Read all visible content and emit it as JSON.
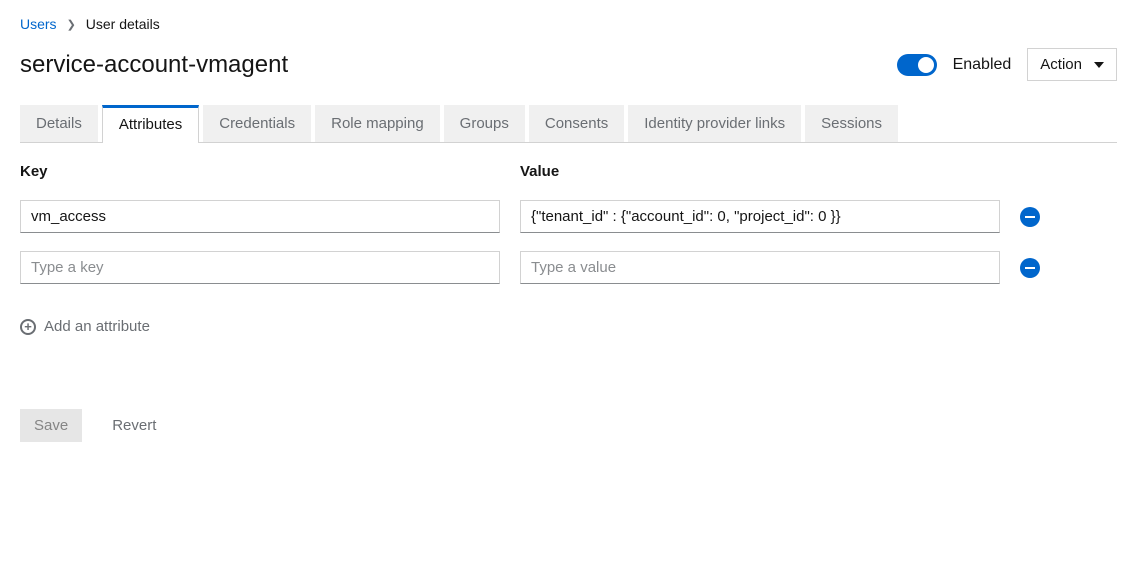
{
  "breadcrumb": {
    "root": "Users",
    "current": "User details"
  },
  "page_title": "service-account-vmagent",
  "switch_label": "Enabled",
  "action_label": "Action",
  "tabs": [
    {
      "label": "Details"
    },
    {
      "label": "Attributes",
      "active": true
    },
    {
      "label": "Credentials"
    },
    {
      "label": "Role mapping"
    },
    {
      "label": "Groups"
    },
    {
      "label": "Consents"
    },
    {
      "label": "Identity provider links"
    },
    {
      "label": "Sessions"
    }
  ],
  "columns": {
    "key": "Key",
    "value": "Value"
  },
  "placeholders": {
    "key": "Type a key",
    "value": "Type a value"
  },
  "rows": [
    {
      "key": "vm_access",
      "value": "{\"tenant_id\" : {\"account_id\": 0, \"project_id\": 0 }}"
    },
    {
      "key": "",
      "value": ""
    }
  ],
  "add_label": "Add an attribute",
  "buttons": {
    "save": "Save",
    "revert": "Revert"
  }
}
